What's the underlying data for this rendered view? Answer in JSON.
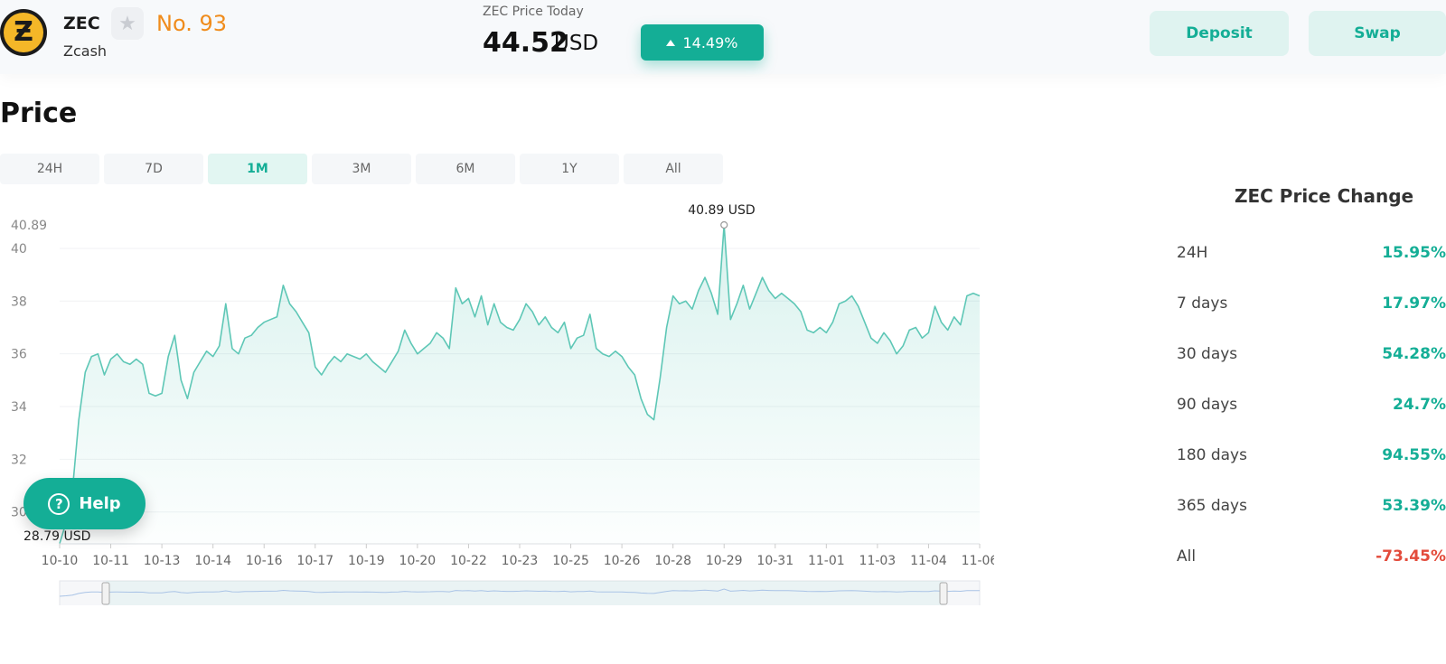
{
  "header": {
    "logo_glyph": "Ƶ",
    "symbol": "ZEC",
    "name": "Zcash",
    "rank": "No. 93",
    "price_label": "ZEC Price Today",
    "price_value": "44.52",
    "price_unit": "USD",
    "change_24h": "14.49%",
    "deposit_label": "Deposit",
    "swap_label": "Swap",
    "star_icon": "star-icon"
  },
  "section": {
    "title": "Price"
  },
  "range_tabs": [
    {
      "label": "24H",
      "active": false
    },
    {
      "label": "7D",
      "active": false
    },
    {
      "label": "1M",
      "active": true
    },
    {
      "label": "3M",
      "active": false
    },
    {
      "label": "6M",
      "active": false
    },
    {
      "label": "1Y",
      "active": false
    },
    {
      "label": "All",
      "active": false
    }
  ],
  "chart_data": {
    "type": "area",
    "unit": "USD",
    "x_ticks": [
      "10-10",
      "10-11",
      "10-13",
      "10-14",
      "10-16",
      "10-17",
      "10-19",
      "10-20",
      "10-22",
      "10-23",
      "10-25",
      "10-26",
      "10-28",
      "10-29",
      "10-31",
      "11-01",
      "11-03",
      "11-04",
      "11-06"
    ],
    "y_ticks": [
      30,
      32,
      34,
      36,
      38,
      40
    ],
    "ylim": [
      28.79,
      40.89
    ],
    "max": {
      "value": 40.89,
      "label": "40.89",
      "unit": "USD"
    },
    "min": {
      "value": 28.79,
      "label": "28.79",
      "unit": "USD"
    },
    "top_tick_label": "40.89",
    "values": [
      28.8,
      29.6,
      30.8,
      33.5,
      35.3,
      35.9,
      36.0,
      35.2,
      35.8,
      36.0,
      35.7,
      35.6,
      35.8,
      35.6,
      34.5,
      34.4,
      34.5,
      35.9,
      36.7,
      35.0,
      34.3,
      35.3,
      35.7,
      36.1,
      35.9,
      36.3,
      37.9,
      36.2,
      36.0,
      36.6,
      36.7,
      37.0,
      37.2,
      37.3,
      37.4,
      38.6,
      37.9,
      37.6,
      37.2,
      36.8,
      35.5,
      35.2,
      35.6,
      35.9,
      35.7,
      36.0,
      35.9,
      35.8,
      36.0,
      35.7,
      35.5,
      35.3,
      35.7,
      36.1,
      36.9,
      36.4,
      36.0,
      36.2,
      36.4,
      36.8,
      36.6,
      36.2,
      38.5,
      37.9,
      38.1,
      37.4,
      38.2,
      37.1,
      37.9,
      37.2,
      37.0,
      36.9,
      37.3,
      37.9,
      37.6,
      37.1,
      37.4,
      37.0,
      36.8,
      37.2,
      36.2,
      36.6,
      36.7,
      37.5,
      36.2,
      36.0,
      35.9,
      36.1,
      35.9,
      35.5,
      35.2,
      34.3,
      33.7,
      33.5,
      35.1,
      37.0,
      38.2,
      37.9,
      38.0,
      37.7,
      38.4,
      38.9,
      38.3,
      37.5,
      40.89,
      37.3,
      37.9,
      38.6,
      37.7,
      38.3,
      38.9,
      38.4,
      38.1,
      38.3,
      38.1,
      37.9,
      37.6,
      36.9,
      36.8,
      37.0,
      36.8,
      37.2,
      37.9,
      38.0,
      38.2,
      37.8,
      37.2,
      36.6,
      36.4,
      36.8,
      36.5,
      36.0,
      36.3,
      36.9,
      37.0,
      36.6,
      36.8,
      37.8,
      37.2,
      36.9,
      37.4,
      37.1,
      38.2,
      38.3,
      38.2
    ]
  },
  "help": {
    "label": "Help",
    "icon_glyph": "?"
  },
  "side": {
    "title": "ZEC Price Change",
    "rows": [
      {
        "label": "24H",
        "value": "15.95%",
        "negative": false
      },
      {
        "label": "7 days",
        "value": "17.97%",
        "negative": false
      },
      {
        "label": "30 days",
        "value": "54.28%",
        "negative": false
      },
      {
        "label": "90 days",
        "value": "24.7%",
        "negative": false
      },
      {
        "label": "180 days",
        "value": "94.55%",
        "negative": false
      },
      {
        "label": "365 days",
        "value": "53.39%",
        "negative": false
      },
      {
        "label": "All",
        "value": "-73.45%",
        "negative": true
      }
    ]
  },
  "colors": {
    "accent": "#14ae96",
    "negative": "#e34b3b",
    "rank": "#f08c1c",
    "line": "#5ec7b6"
  }
}
